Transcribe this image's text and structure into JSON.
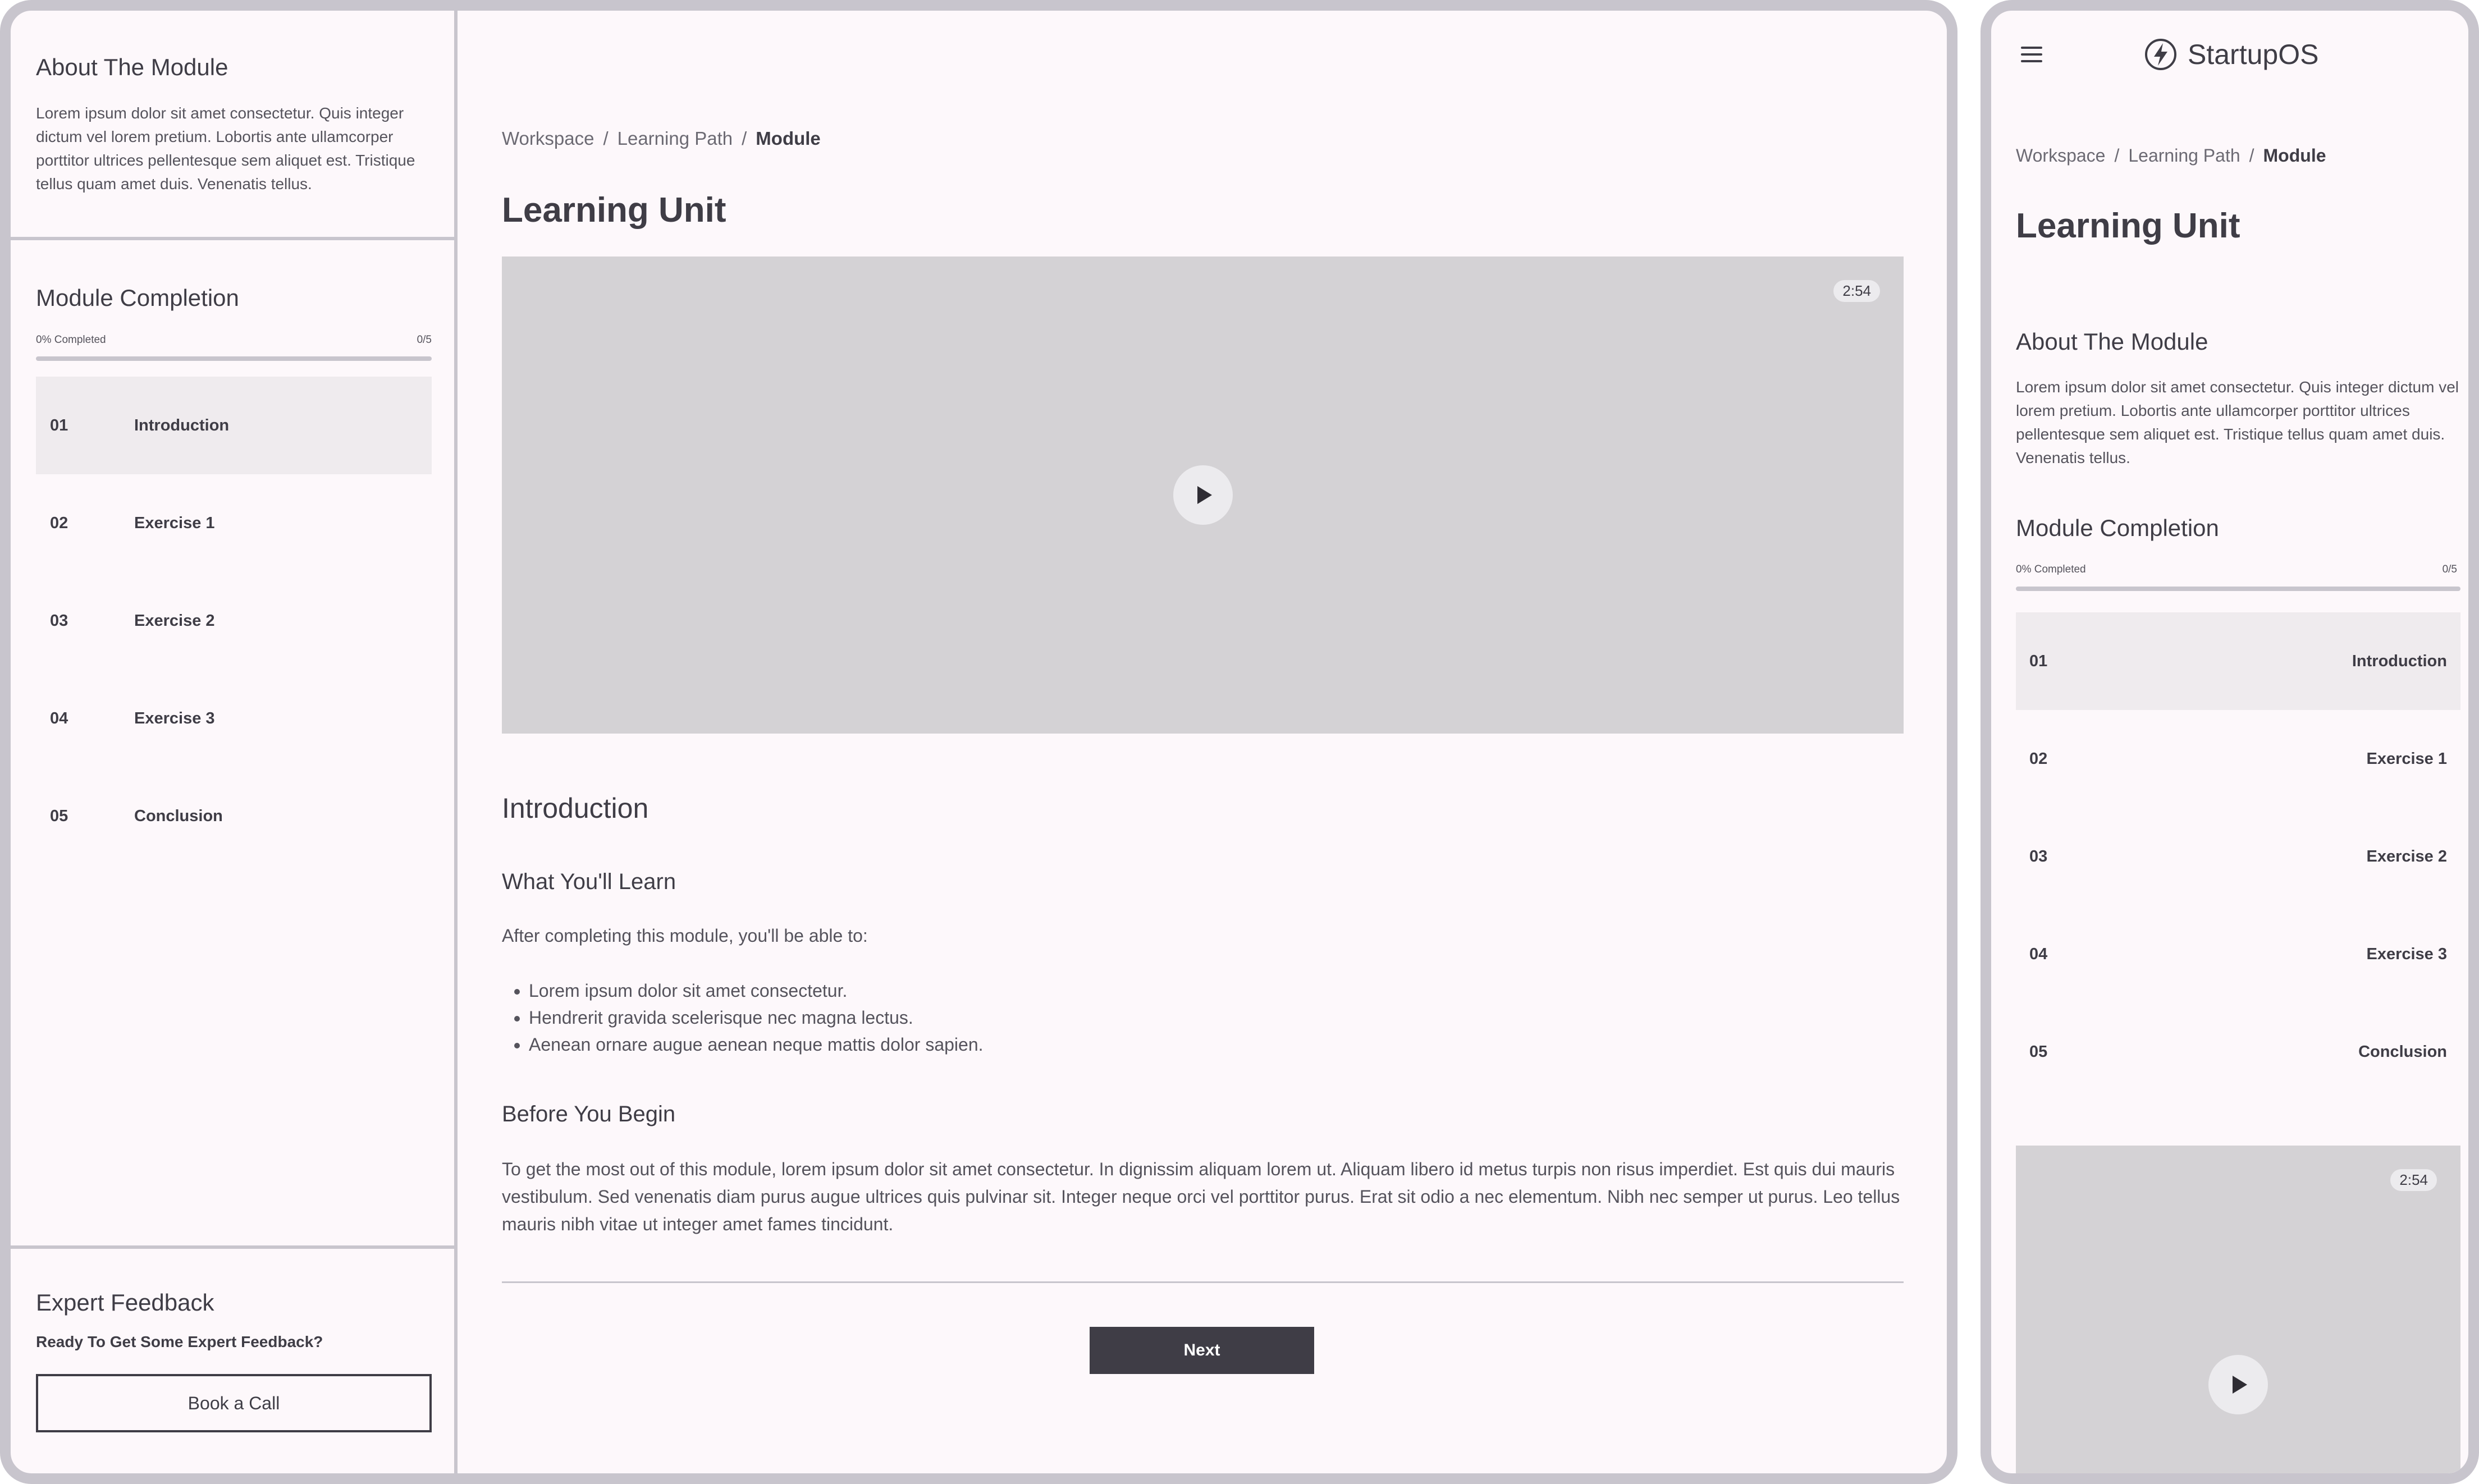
{
  "brand": {
    "name": "StartupOS"
  },
  "breadcrumb": [
    {
      "label": "Workspace"
    },
    {
      "label": "Learning Path"
    },
    {
      "label": "Module"
    }
  ],
  "breadcrumb_separator": "/",
  "page_title": "Learning Unit",
  "about": {
    "title": "About The Module",
    "text": "Lorem ipsum dolor sit amet consectetur. Quis integer dictum vel lorem pretium. Lobortis ante ullamcorper porttitor ultrices pellentesque sem aliquet est. Tristique tellus quam amet duis. Venenatis tellus."
  },
  "completion": {
    "title": "Module Completion",
    "percent_label": "0% Completed",
    "count_label": "0/5",
    "progress": 0
  },
  "units": [
    {
      "num": "01",
      "label": "Introduction",
      "active": true
    },
    {
      "num": "02",
      "label": "Exercise 1",
      "active": false
    },
    {
      "num": "03",
      "label": "Exercise 2",
      "active": false
    },
    {
      "num": "04",
      "label": "Exercise 3",
      "active": false
    },
    {
      "num": "05",
      "label": "Conclusion",
      "active": false
    }
  ],
  "feedback": {
    "title": "Expert Feedback",
    "prompt": "Ready To Get Some Expert Feedback?",
    "button": "Book a Call"
  },
  "video": {
    "duration": "2:54"
  },
  "content": {
    "section_title": "Introduction",
    "learn_title": "What You'll Learn",
    "learn_intro": "After completing this module, you'll be able to:",
    "learn_points": [
      "Lorem ipsum dolor sit amet consectetur.",
      "Hendrerit gravida scelerisque nec magna lectus.",
      "Aenean ornare augue aenean neque mattis dolor sapien."
    ],
    "before_title": "Before You Begin",
    "before_text": "To get the most out of this module, lorem ipsum dolor sit amet consectetur. In dignissim aliquam lorem ut. Aliquam libero id metus turpis non risus imperdiet. Est quis dui mauris vestibulum. Sed venenatis diam purus augue ultrices quis pulvinar sit. Integer neque orci vel porttitor purus. Erat sit odio a nec elementum. Nibh nec semper ut purus. Leo tellus mauris nibh vitae ut integer amet fames tincidunt."
  },
  "next_button": "Next",
  "colors": {
    "frame": "#c8c5cd",
    "surface": "#fdf8fb",
    "primary": "#3f3d46",
    "video_bg": "#d4d2d5"
  }
}
